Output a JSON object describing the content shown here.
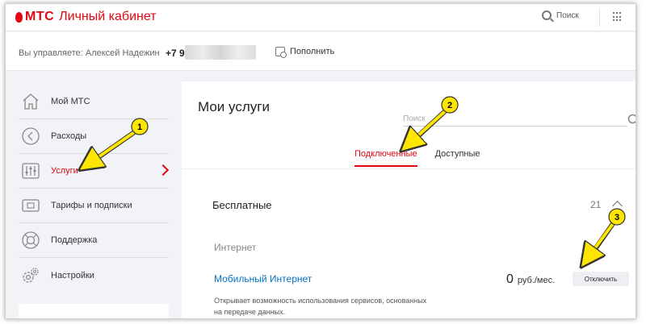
{
  "header": {
    "brand": "МТС",
    "title": "Личный кабинет",
    "search_label": "Поиск"
  },
  "manage": {
    "prefix": "Вы управляете: Алексей Надежин",
    "phone": "+7 9",
    "topup_label": "Пополнить"
  },
  "sidebar": {
    "items": [
      {
        "label": "Мой МТС",
        "icon": "home-icon"
      },
      {
        "label": "Расходы",
        "icon": "expenses-icon"
      },
      {
        "label": "Услуги",
        "icon": "sliders-icon"
      },
      {
        "label": "Тарифы и подписки",
        "icon": "tariff-card-icon"
      },
      {
        "label": "Поддержка",
        "icon": "lifebuoy-icon"
      },
      {
        "label": "Настройки",
        "icon": "gears-icon"
      }
    ],
    "active_index": 2
  },
  "main": {
    "title": "Мои услуги",
    "search_placeholder": "Поиск",
    "tabs": [
      {
        "label": "Подключенные",
        "active": true
      },
      {
        "label": "Доступные",
        "active": false
      }
    ],
    "section": {
      "title": "Бесплатные",
      "count": "21"
    },
    "category": "Интернет",
    "service": {
      "name": "Мобильный Интернет",
      "description": "Открывает возможность использования сервисов, основанных на передаче данных.",
      "price_value": "0",
      "price_unit": "руб./мес.",
      "action_label": "Отключить"
    }
  },
  "annotations": [
    {
      "number": "1",
      "target": "sidebar-item-services"
    },
    {
      "number": "2",
      "target": "tab-connected"
    },
    {
      "number": "3",
      "target": "disconnect-button"
    }
  ],
  "colors": {
    "brand_red": "#e30611",
    "link_blue": "#0073c2",
    "annotation_yellow": "#ffe600"
  }
}
